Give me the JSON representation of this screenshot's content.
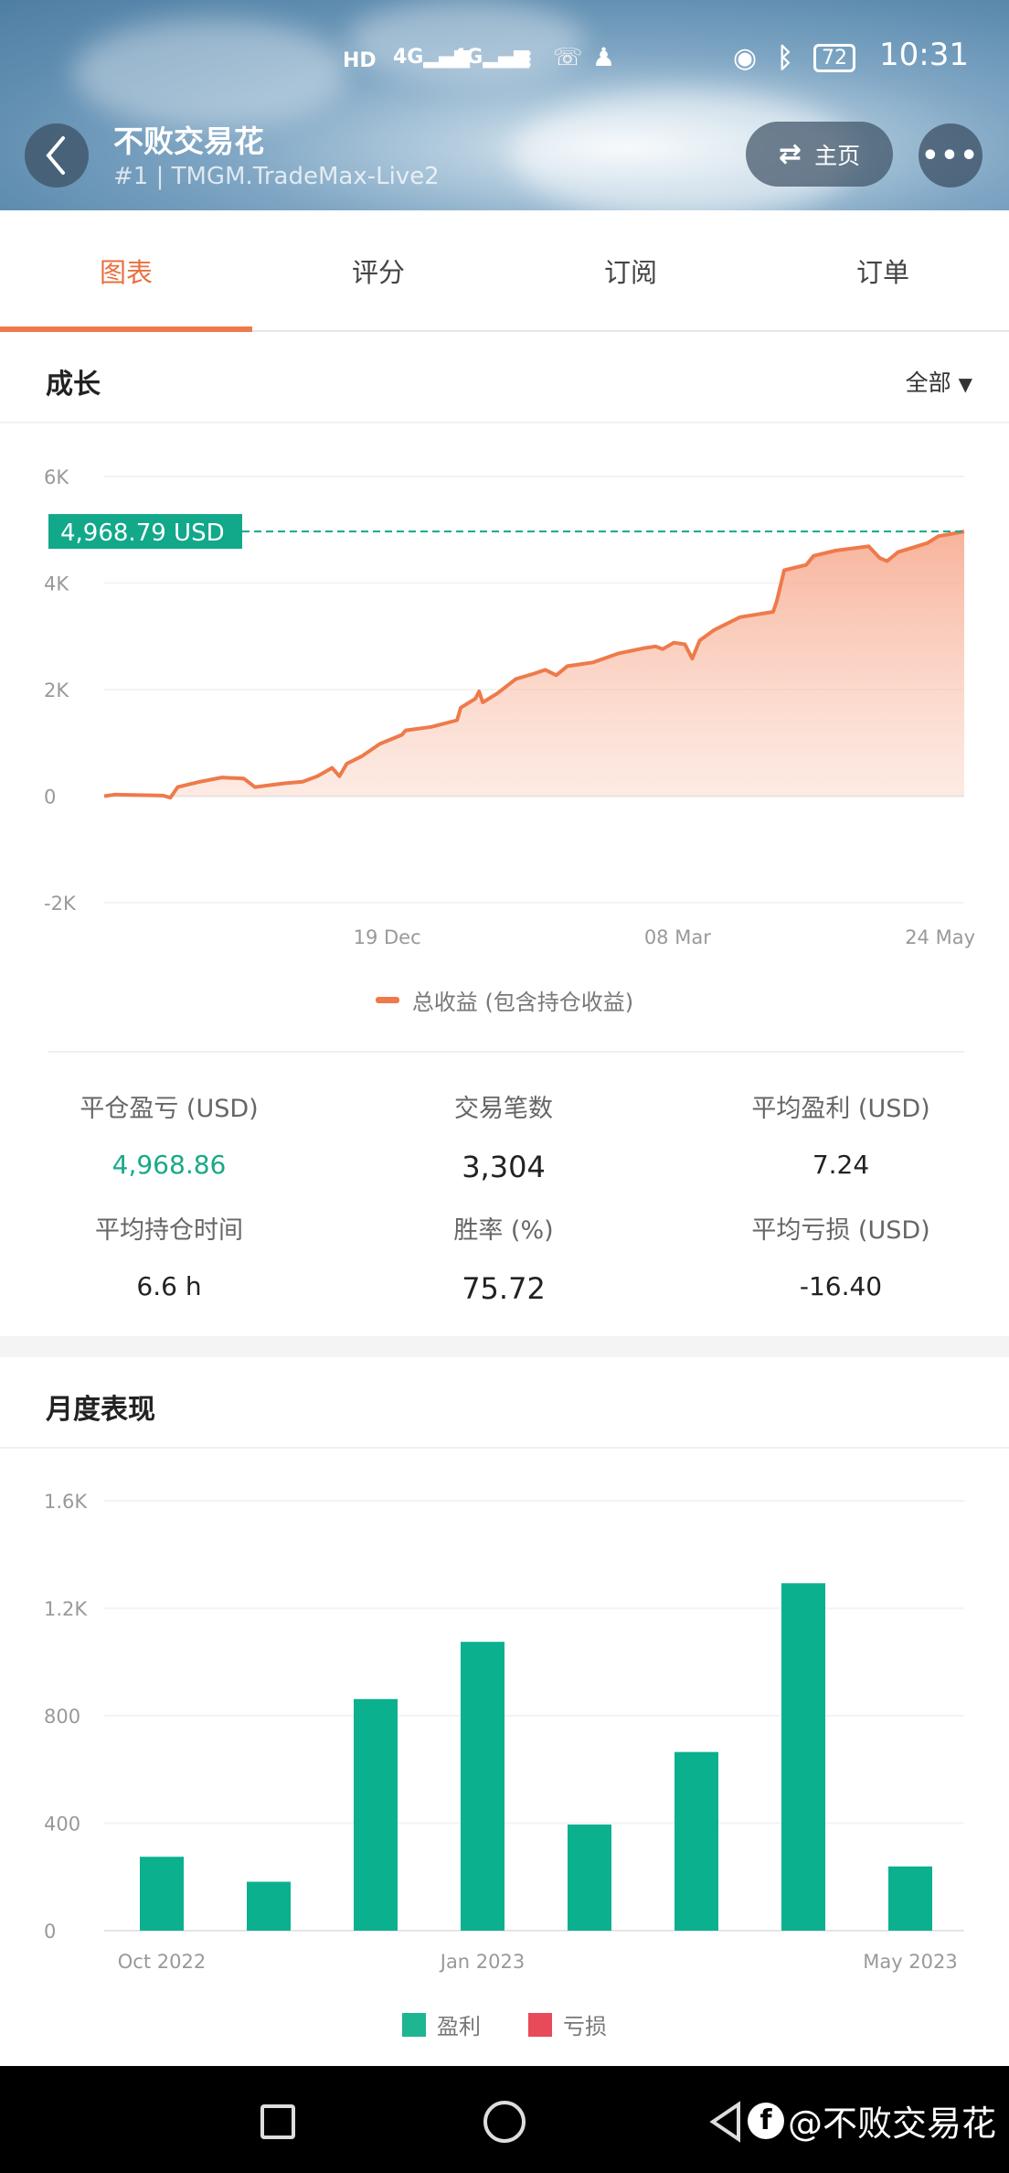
{
  "status_bar": {
    "time": "10:31",
    "battery": "72",
    "icons": [
      "hd-icon",
      "signal-4g-icon",
      "signal-4g-icon",
      "wifi-icon",
      "missed-call-icon",
      "qq-icon",
      "eye-icon",
      "bluetooth-icon",
      "battery-icon"
    ]
  },
  "header": {
    "title": "不败交易花",
    "subtitle": "#1 | TMGM.TradeMax-Live2",
    "home_label": "主页"
  },
  "tabs": [
    {
      "label": "图表",
      "active": true
    },
    {
      "label": "评分"
    },
    {
      "label": "订阅"
    },
    {
      "label": "订单"
    }
  ],
  "growth": {
    "title": "成长",
    "filter": "全部"
  },
  "stats": [
    {
      "label": "平仓盈亏 (USD)",
      "value": "4,968.86",
      "color": "#1aa888"
    },
    {
      "label": "交易笔数",
      "value": "3,304"
    },
    {
      "label": "平均盈利 (USD)",
      "value": "7.24"
    },
    {
      "label": "平均持仓时间",
      "value": "6.6 h"
    },
    {
      "label": "胜率 (%)",
      "value": "75.72"
    },
    {
      "label": "平均亏损 (USD)",
      "value": "-16.40"
    }
  ],
  "monthly": {
    "title": "月度表现"
  },
  "watermark": "@不败交易花",
  "colors": {
    "accent": "#ee7a4b",
    "profit": "#0bb08f",
    "loss": "#e84a5a",
    "current_label": "#12a88a"
  },
  "chart_data": [
    {
      "type": "area",
      "series_name": "总收益 (包含持仓收益)",
      "current_value_label": "4,968.79 USD",
      "current_value": 4968.79,
      "ylim": [
        -2000,
        6000
      ],
      "yticks": [
        "6K",
        "4K",
        "2K",
        "0",
        "-2K"
      ],
      "ytick_values": [
        6000,
        4000,
        2000,
        0,
        -2000
      ],
      "xlim": [
        "2022-10-03",
        "2023-05-25"
      ],
      "xticks": [
        {
          "label": "19 Dec",
          "date": "2022-12-19"
        },
        {
          "label": "08 Mar",
          "date": "2023-03-08"
        },
        {
          "label": "24 May",
          "date": "2023-05-24"
        }
      ],
      "grid": true,
      "legend": "bottom",
      "points": [
        [
          "2022-10-03",
          0
        ],
        [
          "2022-10-06",
          30
        ],
        [
          "2022-10-19",
          10
        ],
        [
          "2022-10-21",
          -30
        ],
        [
          "2022-10-23",
          170
        ],
        [
          "2022-10-29",
          270
        ],
        [
          "2022-11-04",
          350
        ],
        [
          "2022-11-10",
          330
        ],
        [
          "2022-11-13",
          170
        ],
        [
          "2022-11-21",
          240
        ],
        [
          "2022-11-26",
          270
        ],
        [
          "2022-11-30",
          375
        ],
        [
          "2022-12-04",
          530
        ],
        [
          "2022-12-06",
          375
        ],
        [
          "2022-12-08",
          610
        ],
        [
          "2022-12-12",
          745
        ],
        [
          "2022-12-17",
          980
        ],
        [
          "2022-12-23",
          1150
        ],
        [
          "2022-12-24",
          1235
        ],
        [
          "2022-12-31",
          1300
        ],
        [
          "2023-01-07",
          1425
        ],
        [
          "2023-01-08",
          1660
        ],
        [
          "2023-01-12",
          1830
        ],
        [
          "2023-01-13",
          1965
        ],
        [
          "2023-01-14",
          1760
        ],
        [
          "2023-01-18",
          1930
        ],
        [
          "2023-01-23",
          2200
        ],
        [
          "2023-01-28",
          2300
        ],
        [
          "2023-01-31",
          2370
        ],
        [
          "2023-02-03",
          2270
        ],
        [
          "2023-02-06",
          2440
        ],
        [
          "2023-02-13",
          2510
        ],
        [
          "2023-02-20",
          2680
        ],
        [
          "2023-02-27",
          2780
        ],
        [
          "2023-03-02",
          2810
        ],
        [
          "2023-03-04",
          2760
        ],
        [
          "2023-03-07",
          2880
        ],
        [
          "2023-03-10",
          2850
        ],
        [
          "2023-03-12",
          2580
        ],
        [
          "2023-03-14",
          2920
        ],
        [
          "2023-03-18",
          3120
        ],
        [
          "2023-03-25",
          3360
        ],
        [
          "2023-04-03",
          3460
        ],
        [
          "2023-04-04",
          3660
        ],
        [
          "2023-04-06",
          4240
        ],
        [
          "2023-04-12",
          4340
        ],
        [
          "2023-04-14",
          4510
        ],
        [
          "2023-04-20",
          4610
        ],
        [
          "2023-04-29",
          4690
        ],
        [
          "2023-05-02",
          4470
        ],
        [
          "2023-05-04",
          4410
        ],
        [
          "2023-05-07",
          4580
        ],
        [
          "2023-05-15",
          4750
        ],
        [
          "2023-05-18",
          4880
        ],
        [
          "2023-05-21",
          4915
        ],
        [
          "2023-05-25",
          4968.79
        ]
      ]
    },
    {
      "type": "bar",
      "categories": [
        "Oct 2022",
        "Nov 2022",
        "Dec 2022",
        "Jan 2023",
        "Feb 2023",
        "Mar 2023",
        "Apr 2023",
        "May 2023"
      ],
      "xtick_labels": [
        {
          "label": "Oct 2022",
          "index": 0
        },
        {
          "label": "Jan 2023",
          "index": 3
        },
        {
          "label": "May 2023",
          "index": 7
        }
      ],
      "series": [
        {
          "name": "盈利",
          "values": [
            275,
            182,
            862,
            1075,
            395,
            665,
            1293,
            239
          ]
        },
        {
          "name": "亏损",
          "values": [
            0,
            0,
            0,
            0,
            0,
            0,
            0,
            0
          ]
        }
      ],
      "ylim": [
        0,
        1600
      ],
      "yticks": [
        "1.6K",
        "1.2K",
        "800",
        "400",
        "0"
      ],
      "ytick_values": [
        1600,
        1200,
        800,
        400,
        0
      ],
      "grid": true,
      "legend": "bottom"
    }
  ]
}
